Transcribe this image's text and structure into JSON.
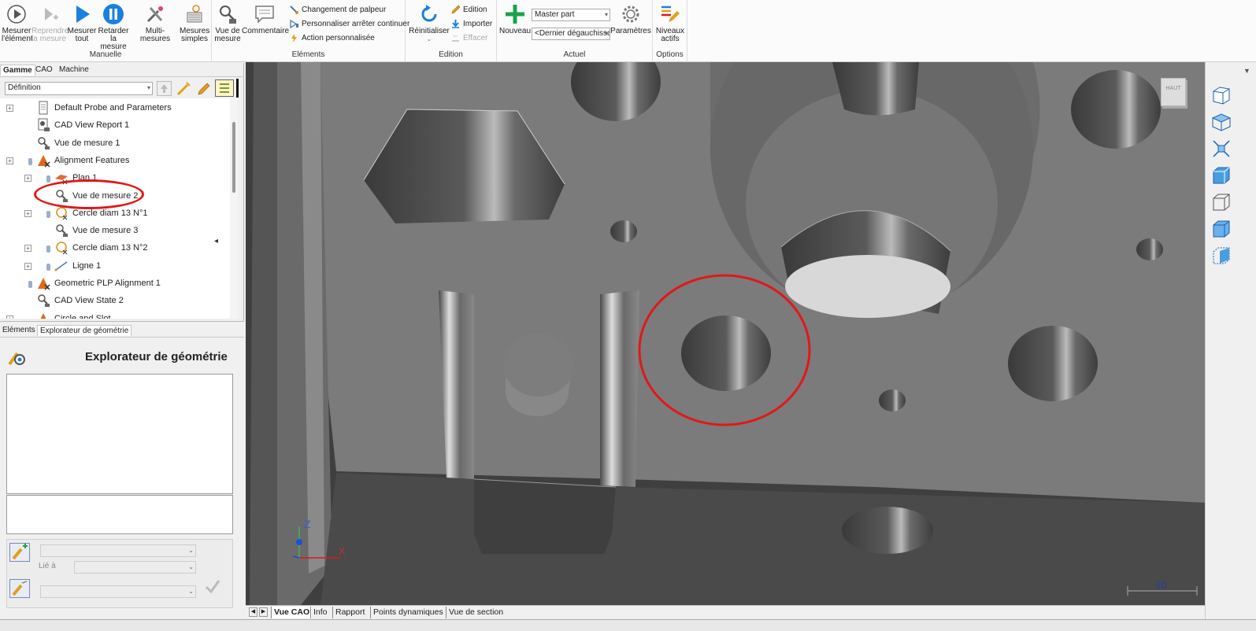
{
  "ribbon": {
    "manuelle": {
      "label": "Manuelle",
      "mesurer_element": "Mesurer\nl'élément",
      "reprendre_mesure": "Reprendre\nla mesure",
      "mesurer_tout": "Mesurer\ntout",
      "retarder_mesure": "Retarder\nla mesure",
      "multi_mesures": "Multi-mesures",
      "mesures_simples": "Mesures\nsimples"
    },
    "elements": {
      "label": "Eléments",
      "vue_mesure": "Vue de\nmesure",
      "commentaire": "Commentaire",
      "changement_palpeur": "Changement de palpeur",
      "personnaliser_arreter": "Personnaliser arrêter continuer",
      "action_personnalisee": "Action personnalisée"
    },
    "edition": {
      "label": "Edition",
      "reinitialiser": "Réinitialiser",
      "edition": "Edition",
      "importer": "Importer",
      "effacer": "Effacer"
    },
    "actuel": {
      "label": "Actuel",
      "nouveau": "Nouveau",
      "part_select": "Master part",
      "alignment_select": "<Dernier dégauchissa",
      "parametres": "Paramètres"
    },
    "options": {
      "label": "Options",
      "niveaux_actifs": "Niveaux\nactifs"
    }
  },
  "left_panel": {
    "tabs": [
      "Gamme",
      "CAO",
      "Machine"
    ],
    "active_tab": "Gamme",
    "definition_select": "Définition",
    "tree": [
      {
        "label": "Default Probe and Parameters",
        "icon": "probe-params-icon"
      },
      {
        "label": "CAD View Report 1",
        "icon": "cad-report-icon"
      },
      {
        "label": "Vue de mesure 1",
        "icon": "measure-view-icon"
      },
      {
        "label": "Alignment Features",
        "icon": "alignment-icon"
      },
      {
        "label": "Plan 1",
        "icon": "plane-icon"
      },
      {
        "label": "Vue de mesure 2",
        "icon": "measure-view-icon"
      },
      {
        "label": "Cercle diam 13 N°1",
        "icon": "circle-icon"
      },
      {
        "label": "Vue de mesure 3",
        "icon": "measure-view-icon"
      },
      {
        "label": "Cercle diam 13 N°2",
        "icon": "circle-icon"
      },
      {
        "label": "Ligne 1",
        "icon": "line-icon"
      },
      {
        "label": "Geometric PLP Alignment 1",
        "icon": "alignment-icon"
      },
      {
        "label": "CAD View State 2",
        "icon": "measure-view-icon"
      },
      {
        "label": "Circle and Slot",
        "icon": "alignment-icon"
      }
    ],
    "lower_tabs": [
      "Eléments",
      "Explorateur de géométrie"
    ],
    "explorer_title": "Explorateur de géométrie",
    "lie_a_label": "Lié à"
  },
  "viewport": {
    "view_cube_label": "HAUT",
    "scale_value": "10",
    "axis_z": "Z",
    "axis_x": "X"
  },
  "bottom_tabs": [
    "Vue CAO",
    "Info",
    "Rapport",
    "Points dynamiques",
    "Vue de section"
  ],
  "colors": {
    "annotation_red": "#e01818",
    "play_blue": "#1a7fe0",
    "add_green": "#1aa34a"
  }
}
